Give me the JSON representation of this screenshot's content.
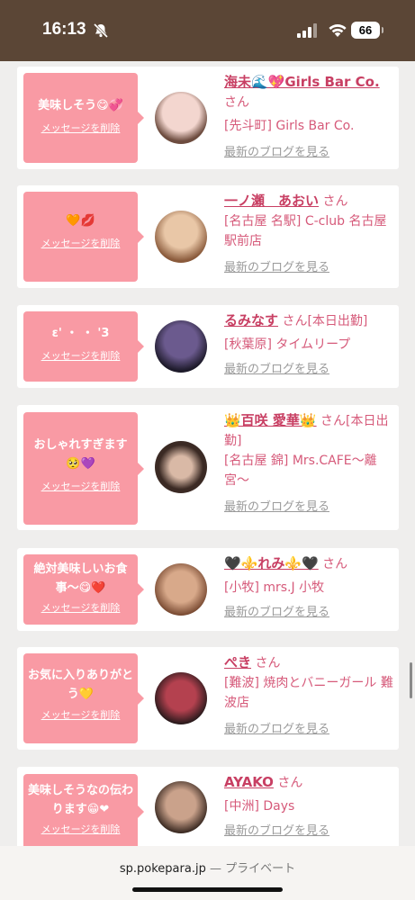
{
  "status": {
    "time": "16:13",
    "battery": "66"
  },
  "cards": [
    {
      "message": "美味しそう😋💞",
      "delete_label": "メッセージを削除",
      "name": "海未🌊💖Girls Bar Co.",
      "san": "さん",
      "shop": "[先斗町] Girls Bar Co.",
      "blog_label": "最新のブログを見る",
      "avatar_colors": [
        "#f3d6cf",
        "#6d4c3f"
      ]
    },
    {
      "message": "🧡💋",
      "delete_label": "メッセージを削除",
      "name": "一ノ瀬　あおい",
      "san": "さん",
      "shop": "[名古屋 名駅] C-club 名古屋駅前店",
      "blog_label": "最新のブログを見る",
      "avatar_colors": [
        "#e9c7a7",
        "#8a5a3b"
      ]
    },
    {
      "message": "ε' ・ ・ '3",
      "delete_label": "メッセージを削除",
      "name": "るみなす",
      "san": "さん[本日出勤]",
      "shop": "[秋葉原] タイムリープ",
      "blog_label": "最新のブログを見る",
      "avatar_colors": [
        "#6b5a8e",
        "#1d1a2a"
      ]
    },
    {
      "message": "おしゃれすぎます🥺💜",
      "delete_label": "メッセージを削除",
      "name": "👑百咲 愛華👑",
      "san": "さん[本日出勤]",
      "shop": "[名古屋 錦] Mrs.CAFE〜離宮〜",
      "blog_label": "最新のブログを見る",
      "avatar_colors": [
        "#3b2a24",
        "#d9b9a6"
      ]
    },
    {
      "message": "絶対美味しいお食事〜😋❤️",
      "delete_label": "メッセージを削除",
      "name": "🖤⚜️れみ⚜️🖤",
      "san": "さん",
      "shop": "[小牧] mrs.J 小牧",
      "blog_label": "最新のブログを見る",
      "avatar_colors": [
        "#d8a98a",
        "#7a4b33"
      ]
    },
    {
      "message": "お気に入りありがとう💛",
      "delete_label": "メッセージを削除",
      "name": "ぺき",
      "san": "さん",
      "shop": "[難波] 焼肉とバニーガール 難波店",
      "blog_label": "最新のブログを見る",
      "avatar_colors": [
        "#b4414f",
        "#2a1a1c"
      ]
    },
    {
      "message": "美味しそうなの伝わります😁❤",
      "delete_label": "メッセージを削除",
      "name": "AYAKO",
      "san": "さん",
      "shop": "[中洲] Days",
      "blog_label": "最新のブログを見る",
      "avatar_colors": [
        "#caa28b",
        "#3b2a22"
      ]
    }
  ],
  "browser": {
    "url": "sp.pokepara.jp",
    "separator": "—",
    "mode": "プライベート"
  }
}
